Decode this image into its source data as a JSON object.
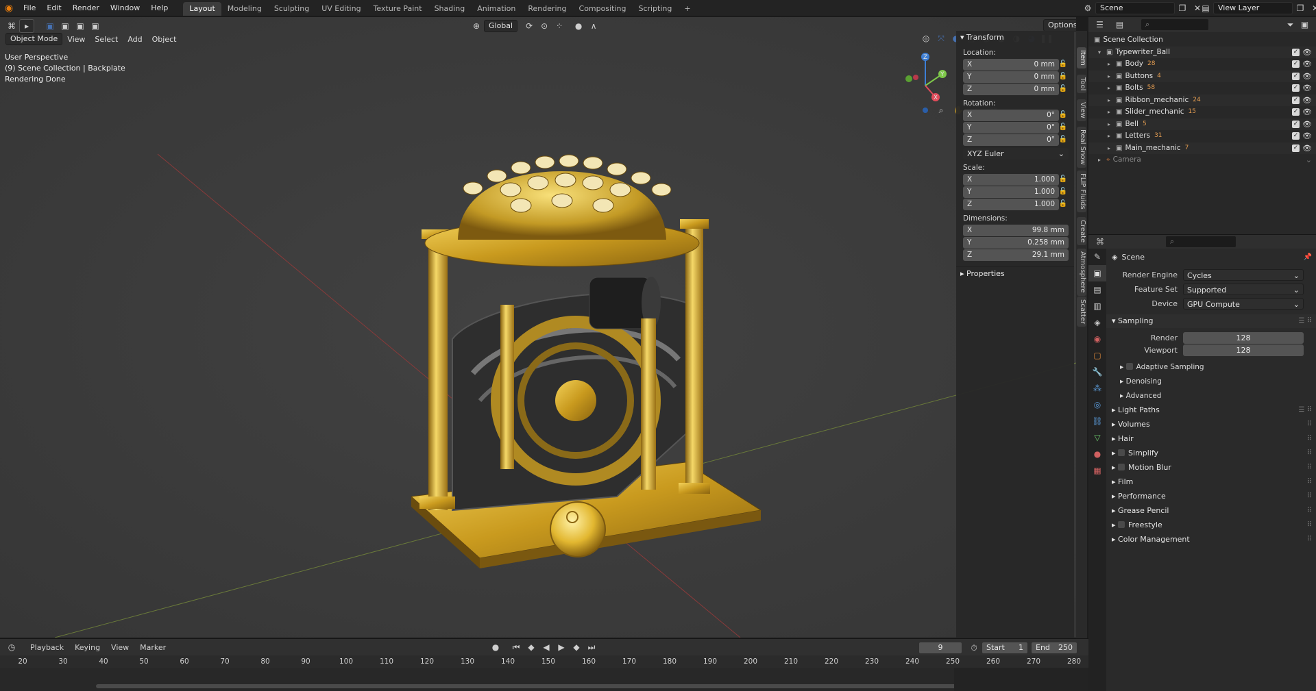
{
  "topbar": {
    "menus": [
      "File",
      "Edit",
      "Render",
      "Window",
      "Help"
    ],
    "workspaces": [
      "Layout",
      "Modeling",
      "Sculpting",
      "UV Editing",
      "Texture Paint",
      "Shading",
      "Animation",
      "Rendering",
      "Compositing",
      "Scripting"
    ],
    "active_workspace": "Layout",
    "add_tab": "+",
    "scene_name": "Scene",
    "view_layer_name": "View Layer"
  },
  "viewport_header": {
    "mode": "Object Mode",
    "menus": [
      "View",
      "Select",
      "Add",
      "Object"
    ],
    "orientation": "Global",
    "options_label": "Options"
  },
  "viewport_overlay": {
    "line1": "User Perspective",
    "line2": "(9) Scene Collection | Backplate",
    "line3": "Rendering Done"
  },
  "npanel": {
    "transform_title": "Transform",
    "location_label": "Location:",
    "location": [
      {
        "axis": "X",
        "value": "0 mm"
      },
      {
        "axis": "Y",
        "value": "0 mm"
      },
      {
        "axis": "Z",
        "value": "0 mm"
      }
    ],
    "rotation_label": "Rotation:",
    "rotation": [
      {
        "axis": "X",
        "value": "0°"
      },
      {
        "axis": "Y",
        "value": "0°"
      },
      {
        "axis": "Z",
        "value": "0°"
      }
    ],
    "rotation_mode": "XYZ Euler",
    "scale_label": "Scale:",
    "scale": [
      {
        "axis": "X",
        "value": "1.000"
      },
      {
        "axis": "Y",
        "value": "1.000"
      },
      {
        "axis": "Z",
        "value": "1.000"
      }
    ],
    "dimensions_label": "Dimensions:",
    "dimensions": [
      {
        "axis": "X",
        "value": "99.8 mm"
      },
      {
        "axis": "Y",
        "value": "0.258 mm"
      },
      {
        "axis": "Z",
        "value": "29.1 mm"
      }
    ],
    "properties_title": "Properties"
  },
  "vertical_tabs": [
    "Item",
    "Tool",
    "View",
    "Real Snow",
    "FLIP Fluids",
    "Create",
    "Atmosphere",
    "Scatter"
  ],
  "outliner": {
    "root": "Scene Collection",
    "collection": "Typewriter_Ball",
    "items": [
      {
        "name": "Body",
        "badge": "28"
      },
      {
        "name": "Buttons",
        "badge": "4"
      },
      {
        "name": "Bolts",
        "badge": "58"
      },
      {
        "name": "Ribbon_mechanic",
        "badge": "24"
      },
      {
        "name": "Slider_mechanic",
        "badge": "15"
      },
      {
        "name": "Bell",
        "badge": "5"
      },
      {
        "name": "Letters",
        "badge": "31"
      },
      {
        "name": "Main_mechanic",
        "badge": "7"
      }
    ],
    "camera": "Camera"
  },
  "properties": {
    "context": "Scene",
    "render_engine_label": "Render Engine",
    "render_engine": "Cycles",
    "feature_set_label": "Feature Set",
    "feature_set": "Supported",
    "device_label": "Device",
    "device": "GPU Compute",
    "sampling_title": "Sampling",
    "render_label": "Render",
    "render_samples": "128",
    "viewport_label": "Viewport",
    "viewport_samples": "128",
    "adaptive_sampling": "Adaptive Sampling",
    "denoising": "Denoising",
    "advanced": "Advanced",
    "sections": [
      "Light Paths",
      "Volumes",
      "Hair",
      "Simplify",
      "Motion Blur",
      "Film",
      "Performance",
      "Grease Pencil",
      "Freestyle",
      "Color Management"
    ]
  },
  "timeline": {
    "menus": [
      "Playback",
      "Keying",
      "View",
      "Marker"
    ],
    "current_frame": "9",
    "start_label": "Start",
    "start": "1",
    "end_label": "End",
    "end": "250",
    "ticks": [
      "20",
      "30",
      "40",
      "50",
      "60",
      "70",
      "80",
      "90",
      "100",
      "110",
      "120",
      "130",
      "140",
      "150",
      "160",
      "170",
      "180",
      "190",
      "200",
      "210",
      "220",
      "230",
      "240",
      "250",
      "260",
      "270",
      "280"
    ]
  },
  "colors": {
    "accent": "#4772b3",
    "gizmo_x": "#e34b5a",
    "gizmo_y": "#7ec84a",
    "gizmo_z": "#3d7fd6",
    "brass": "#c9a22a"
  }
}
